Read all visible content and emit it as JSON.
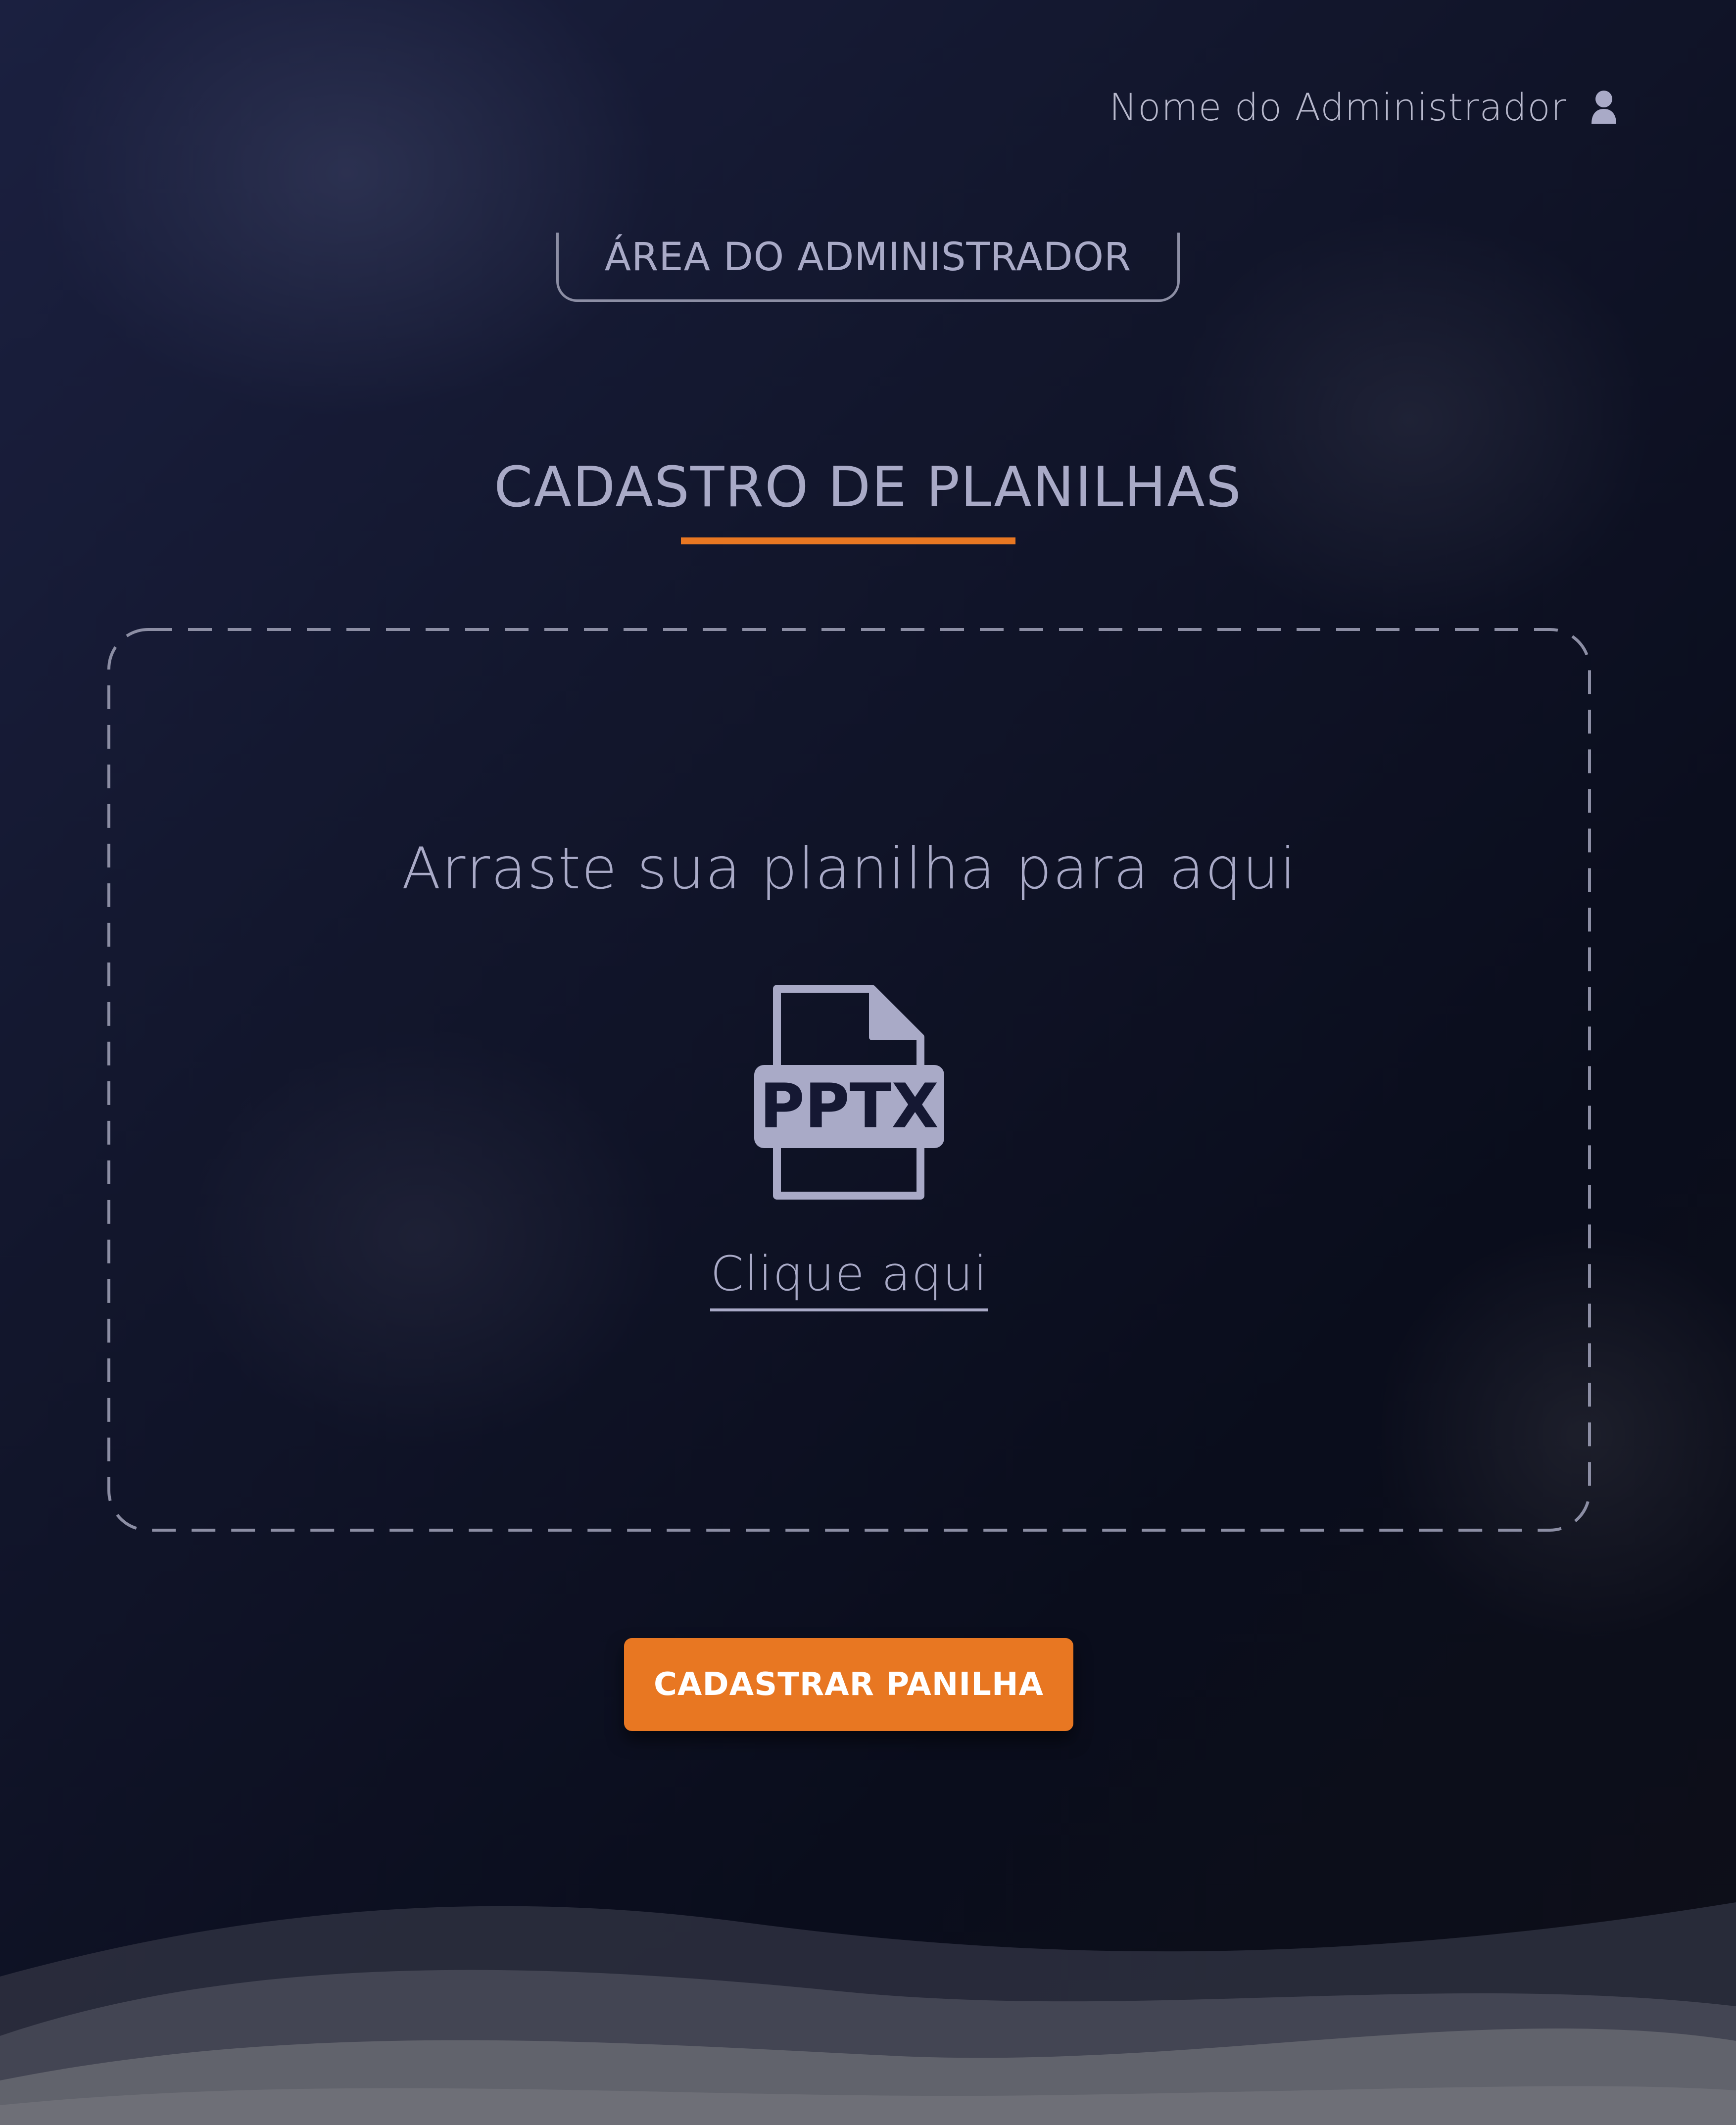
{
  "header": {
    "user_name": "Nome do Administrador",
    "user_icon": "user-icon"
  },
  "admin_badge": {
    "label": "ÁREA DO ADMINISTRADOR"
  },
  "page": {
    "title": "CADASTRO DE PLANILHAS"
  },
  "upload": {
    "drop_text": "Arraste sua planilha para aqui",
    "file_icon": "pptx-file-icon",
    "file_icon_text": "PPTX",
    "click_label": "Clique aqui"
  },
  "actions": {
    "submit_label": "CADASTRAR PANILHA"
  },
  "colors": {
    "accent": "#e87722",
    "text": "#a9aac7",
    "background": "#0d1122"
  }
}
